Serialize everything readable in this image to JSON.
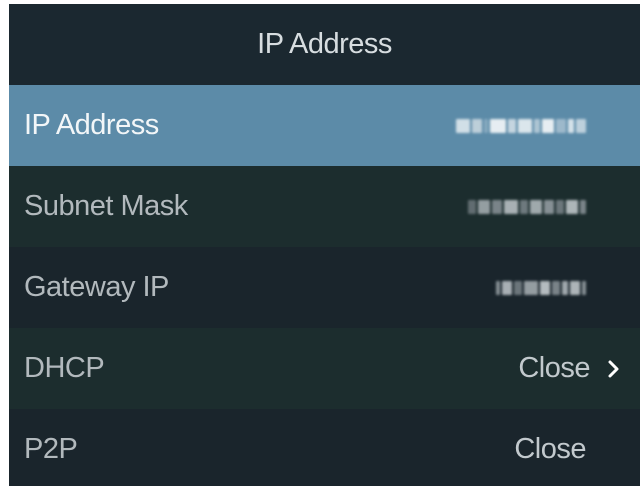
{
  "header": {
    "title": "IP Address"
  },
  "rows": [
    {
      "label": "IP Address",
      "value": "",
      "value_hidden": true
    },
    {
      "label": "Subnet Mask",
      "value": "",
      "value_hidden": true
    },
    {
      "label": "Gateway IP",
      "value": "",
      "value_hidden": true
    },
    {
      "label": "DHCP",
      "value": "Close",
      "icon": "chevron-right-icon"
    },
    {
      "label": "P2P",
      "value": "Close"
    }
  ],
  "colors": {
    "background": "#1a252c",
    "row_alt": "#1c2d2e",
    "selected": "#5c8ba8",
    "text": "#b2b9bd"
  }
}
